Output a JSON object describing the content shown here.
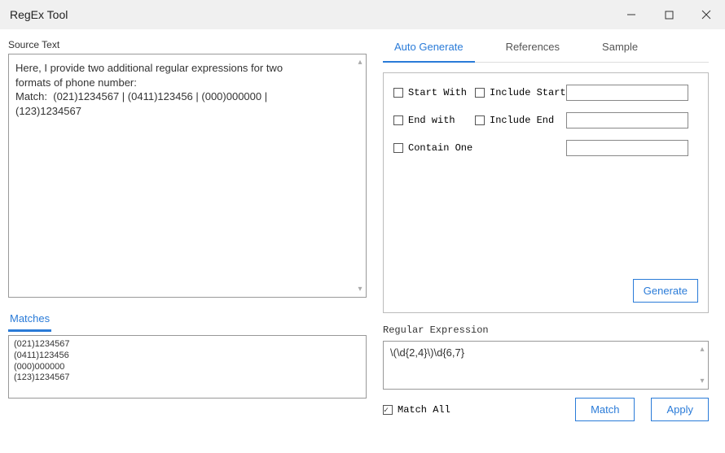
{
  "titlebar": {
    "title": "RegEx Tool"
  },
  "left": {
    "source_label": "Source Text",
    "source_text": "Here, I provide two additional regular expressions for two\nformats of phone number:\nMatch:  (021)1234567 | (0411)123456 | (000)000000 |\n(123)1234567",
    "matches_tab": "Matches",
    "matches_list": [
      "(021)1234567",
      "(0411)123456",
      "(000)000000",
      "(123)1234567"
    ]
  },
  "right": {
    "tabs": {
      "auto": "Auto Generate",
      "references": "References",
      "sample": "Sample"
    },
    "options": {
      "start_with": "Start With",
      "include_start": "Include Start",
      "end_with": "End with",
      "include_end": "Include End",
      "contain_one": "Contain One"
    },
    "option_values": {
      "start_with": "",
      "end_with": "",
      "contain_one": ""
    },
    "generate_btn": "Generate",
    "regex_label": "Regular Expression",
    "regex_value": "\\(\\d{2,4}\\)\\d{6,7}",
    "match_all": "Match All",
    "match_btn": "Match",
    "apply_btn": "Apply"
  }
}
